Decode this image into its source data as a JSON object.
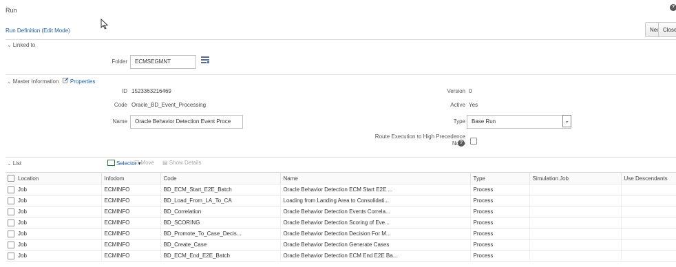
{
  "header": {
    "title": "Run",
    "breadcrumb": "Run Definition (Edit Mode)",
    "next_label": "Next",
    "close_label": "Close"
  },
  "linked_to": {
    "section_label": "Linked to",
    "folder_label": "Folder",
    "folder_value": "ECMSEGMNT"
  },
  "master": {
    "section_label": "Master Information",
    "properties_label": "Properties",
    "id_label": "ID",
    "id_value": "1523363216469",
    "code_label": "Code",
    "code_value": "Oracle_BD_Event_Processing",
    "name_label": "Name",
    "name_value": "Oracle Behavior Detection Event Proce",
    "version_label": "Version",
    "version_value": "0",
    "active_label": "Active",
    "active_value": "Yes",
    "type_label": "Type",
    "type_value": "Base Run",
    "route_label_line1": "Route Execution to High Precedence",
    "route_label_line2": "Node"
  },
  "list": {
    "section_label": "List",
    "toolbar": {
      "selector": "Selector",
      "move": "Move",
      "show_details": "Show Details"
    },
    "columns": [
      "Location",
      "Infodom",
      "Code",
      "Name",
      "Type",
      "Simulation Job",
      "Use Descendants"
    ],
    "rows": [
      [
        "Job",
        "ECMINFO",
        "BD_ECM_Start_E2E_Batch",
        "Oracle Behavior Detection ECM Start E2E ...",
        "Process",
        "",
        ""
      ],
      [
        "Job",
        "ECMINFO",
        "BD_Load_From_LA_To_CA",
        "Loading from Landing Area to Consolidati...",
        "Process",
        "",
        ""
      ],
      [
        "Job",
        "ECMINFO",
        "BD_Correlation",
        "Oracle Behavior Detection Events Correla...",
        "Process",
        "",
        ""
      ],
      [
        "Job",
        "ECMINFO",
        "BD_SCORING",
        "Oracle Behavior Detection Scoring of Eve...",
        "Process",
        "",
        ""
      ],
      [
        "Job",
        "ECMINFO",
        "BD_Promote_To_Case_Decis...",
        "Oracle Behavior Detection Decision For M...",
        "Process",
        "",
        ""
      ],
      [
        "Job",
        "ECMINFO",
        "BD_Create_Case",
        "Oracle Behavior Detection Generate Cases",
        "Process",
        "",
        ""
      ],
      [
        "Job",
        "ECMINFO",
        "BD_ECM_End_E2E_Batch",
        "Oracle Behavior Detection ECM End E2E Ba...",
        "Process",
        "",
        ""
      ]
    ]
  },
  "colors": {
    "link": "#1f5fa8",
    "border": "#c9c9c9"
  },
  "icons": [
    "help-icon",
    "cursor-icon",
    "folder-browse-icon",
    "edit-icon",
    "dropdown-icon",
    "info-icon",
    "selector-icon",
    "move-icon",
    "details-icon",
    "chevron-down-icon"
  ]
}
